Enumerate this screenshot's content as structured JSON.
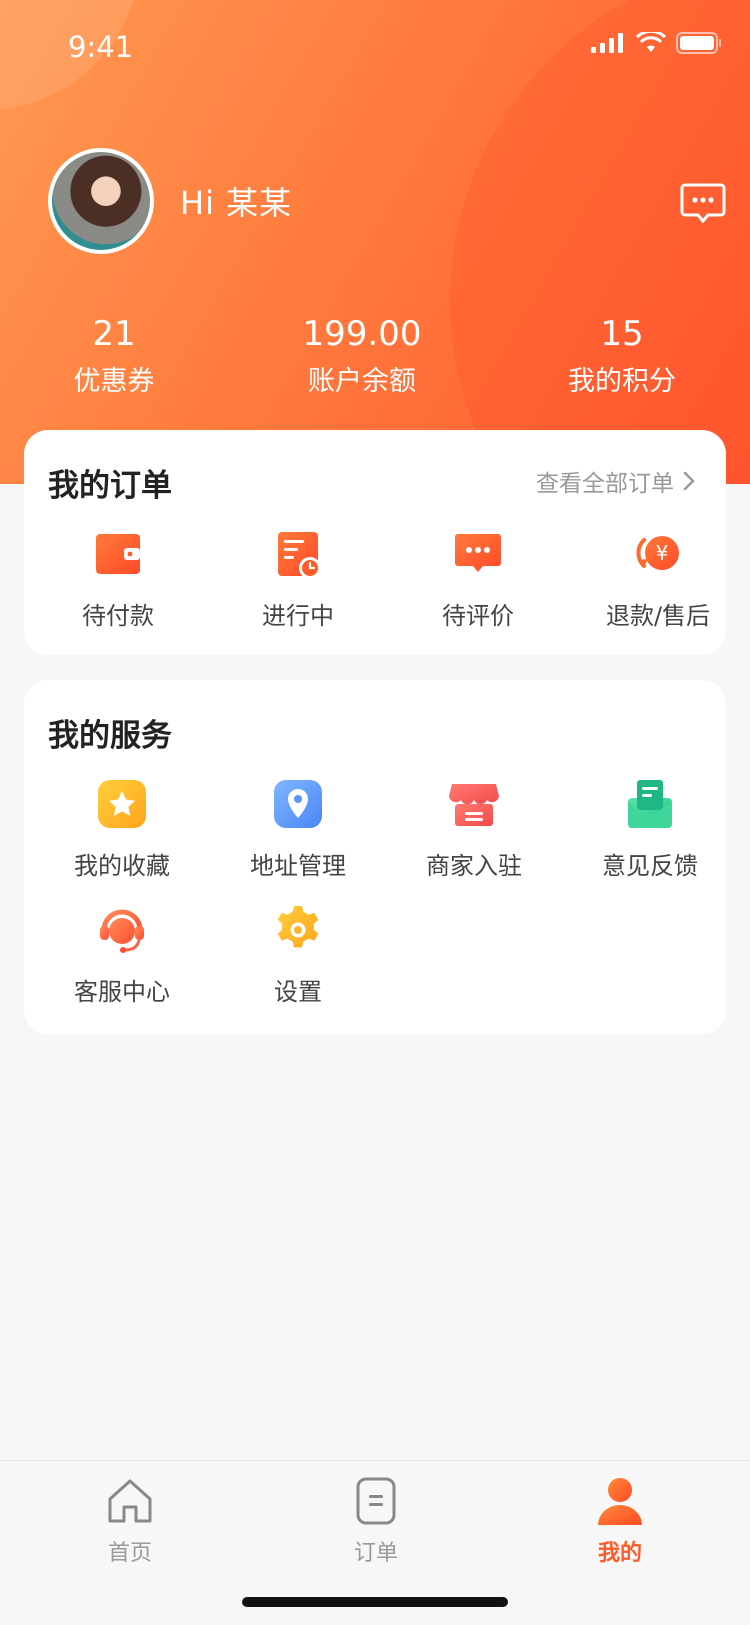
{
  "status_bar": {
    "time": "9:41"
  },
  "profile": {
    "greeting": "Hi  某某"
  },
  "stats": [
    {
      "value": "21",
      "label": "优惠券"
    },
    {
      "value": "199.00",
      "label": "账户余额"
    },
    {
      "value": "15",
      "label": "我的积分"
    }
  ],
  "orders": {
    "title": "我的订单",
    "view_all": "查看全部订单",
    "items": [
      {
        "label": "待付款",
        "icon": "wallet-icon"
      },
      {
        "label": "进行中",
        "icon": "order-progress-icon"
      },
      {
        "label": "待评价",
        "icon": "comment-icon"
      },
      {
        "label": "退款/售后",
        "icon": "refund-icon"
      }
    ]
  },
  "services": {
    "title": "我的服务",
    "items": [
      {
        "label": "我的收藏",
        "icon": "star-icon"
      },
      {
        "label": "地址管理",
        "icon": "location-icon"
      },
      {
        "label": "商家入驻",
        "icon": "store-icon"
      },
      {
        "label": "意见反馈",
        "icon": "feedback-icon"
      },
      {
        "label": "客服中心",
        "icon": "headset-icon"
      },
      {
        "label": "设置",
        "icon": "gear-icon"
      }
    ]
  },
  "tabbar": {
    "tabs": [
      {
        "label": "首页",
        "icon": "home-icon"
      },
      {
        "label": "订单",
        "icon": "order-icon"
      },
      {
        "label": "我的",
        "icon": "person-icon",
        "active": true
      }
    ]
  },
  "colors": {
    "accent": "#ff5a28",
    "header_start": "#ff9a52",
    "header_end": "#ff5a32"
  }
}
